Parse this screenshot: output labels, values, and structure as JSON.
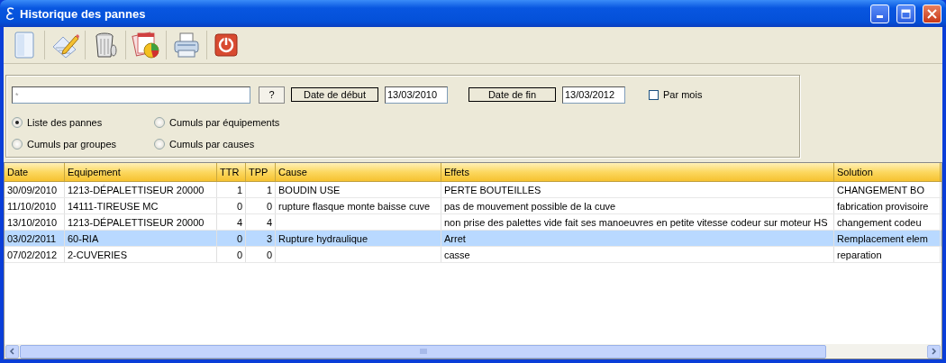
{
  "window": {
    "title": "Historique des pannes"
  },
  "toolbar": [
    {
      "kind": "new"
    },
    {
      "kind": "edit"
    },
    {
      "kind": "delete"
    },
    {
      "kind": "report"
    },
    {
      "kind": "print"
    },
    {
      "kind": "quit"
    }
  ],
  "filters": {
    "search": {
      "placeholder": "*"
    },
    "help_button": "?",
    "start_label": "Date de début",
    "start_date": "13/03/2010",
    "end_label": "Date de fin",
    "end_date": "13/03/2012",
    "monthly": {
      "label": "Par mois",
      "checked": false
    },
    "views": [
      {
        "label": "Liste des pannes",
        "selected": true
      },
      {
        "label": "Cumuls par équipements",
        "selected": false
      },
      {
        "label": "Cumuls par groupes",
        "selected": false
      },
      {
        "label": "Cumuls par causes",
        "selected": false
      }
    ]
  },
  "table": {
    "columns": [
      {
        "label": "Date",
        "kind": "text"
      },
      {
        "label": "Equipement",
        "kind": "text"
      },
      {
        "label": "TTR",
        "kind": "number"
      },
      {
        "label": "TPP",
        "kind": "number"
      },
      {
        "label": "Cause",
        "kind": "text"
      },
      {
        "label": "Effets",
        "kind": "text"
      },
      {
        "label": "Solution",
        "kind": "text"
      }
    ],
    "rows": [
      {
        "selected": false,
        "cells": [
          "30/09/2010",
          "1213-DÉPALETTISEUR 20000",
          "1",
          "1",
          "BOUDIN USE",
          "PERTE BOUTEILLES",
          "CHANGEMENT BO"
        ]
      },
      {
        "selected": false,
        "cells": [
          "11/10/2010",
          "14111-TIREUSE MC",
          "0",
          "0",
          "rupture flasque monte baisse cuve",
          "pas de mouvement possible de la cuve",
          "fabrication provisoire"
        ]
      },
      {
        "selected": false,
        "cells": [
          "13/10/2010",
          "1213-DÉPALETTISEUR 20000",
          "4",
          "4",
          "",
          "non prise des palettes vide fait ses manoeuvres en petite vitesse codeur sur moteur HS",
          "changement codeu"
        ]
      },
      {
        "selected": true,
        "cells": [
          "03/02/2011",
          "60-RIA",
          "0",
          "3",
          "Rupture hydraulique",
          "Arret",
          "Remplacement elem"
        ]
      },
      {
        "selected": false,
        "cells": [
          "07/02/2012",
          "2-CUVERIES",
          "0",
          "0",
          "",
          "casse",
          "reparation"
        ]
      }
    ]
  }
}
